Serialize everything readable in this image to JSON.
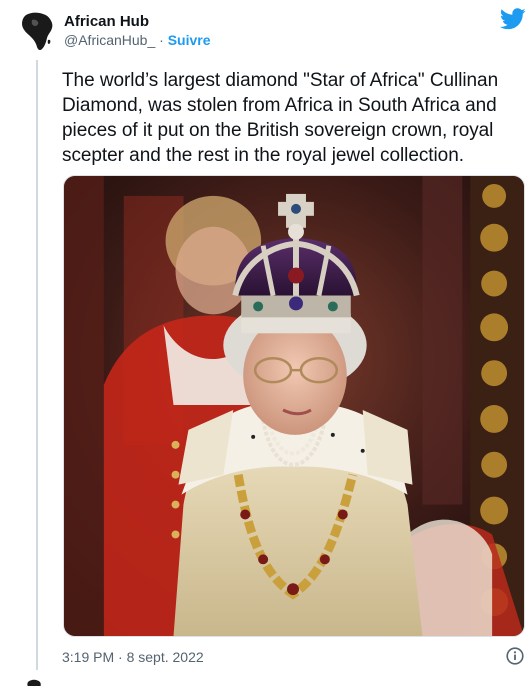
{
  "author": {
    "display_name": "African Hub",
    "handle": "@AfricanHub_",
    "separator": "·",
    "follow_label": "Suivre",
    "avatar_icon": "africa-map-avatar"
  },
  "platform_icon": "twitter-bird-icon",
  "tweet": {
    "text": "The world’s largest diamond \"Star of Africa\" Cullinan Diamond, was stolen from Africa in South Africa and pieces of it put on the British sovereign crown, royal scepter and the rest in the royal jewel collection."
  },
  "media": {
    "type": "photo"
  },
  "footer": {
    "timestamp": "3:19 PM · 8 sept. 2022",
    "info_icon": "info-icon"
  },
  "colors": {
    "accent": "#1d9bf0",
    "text": "#0f1419",
    "muted": "#536471",
    "thread_line": "#cfd9de"
  }
}
